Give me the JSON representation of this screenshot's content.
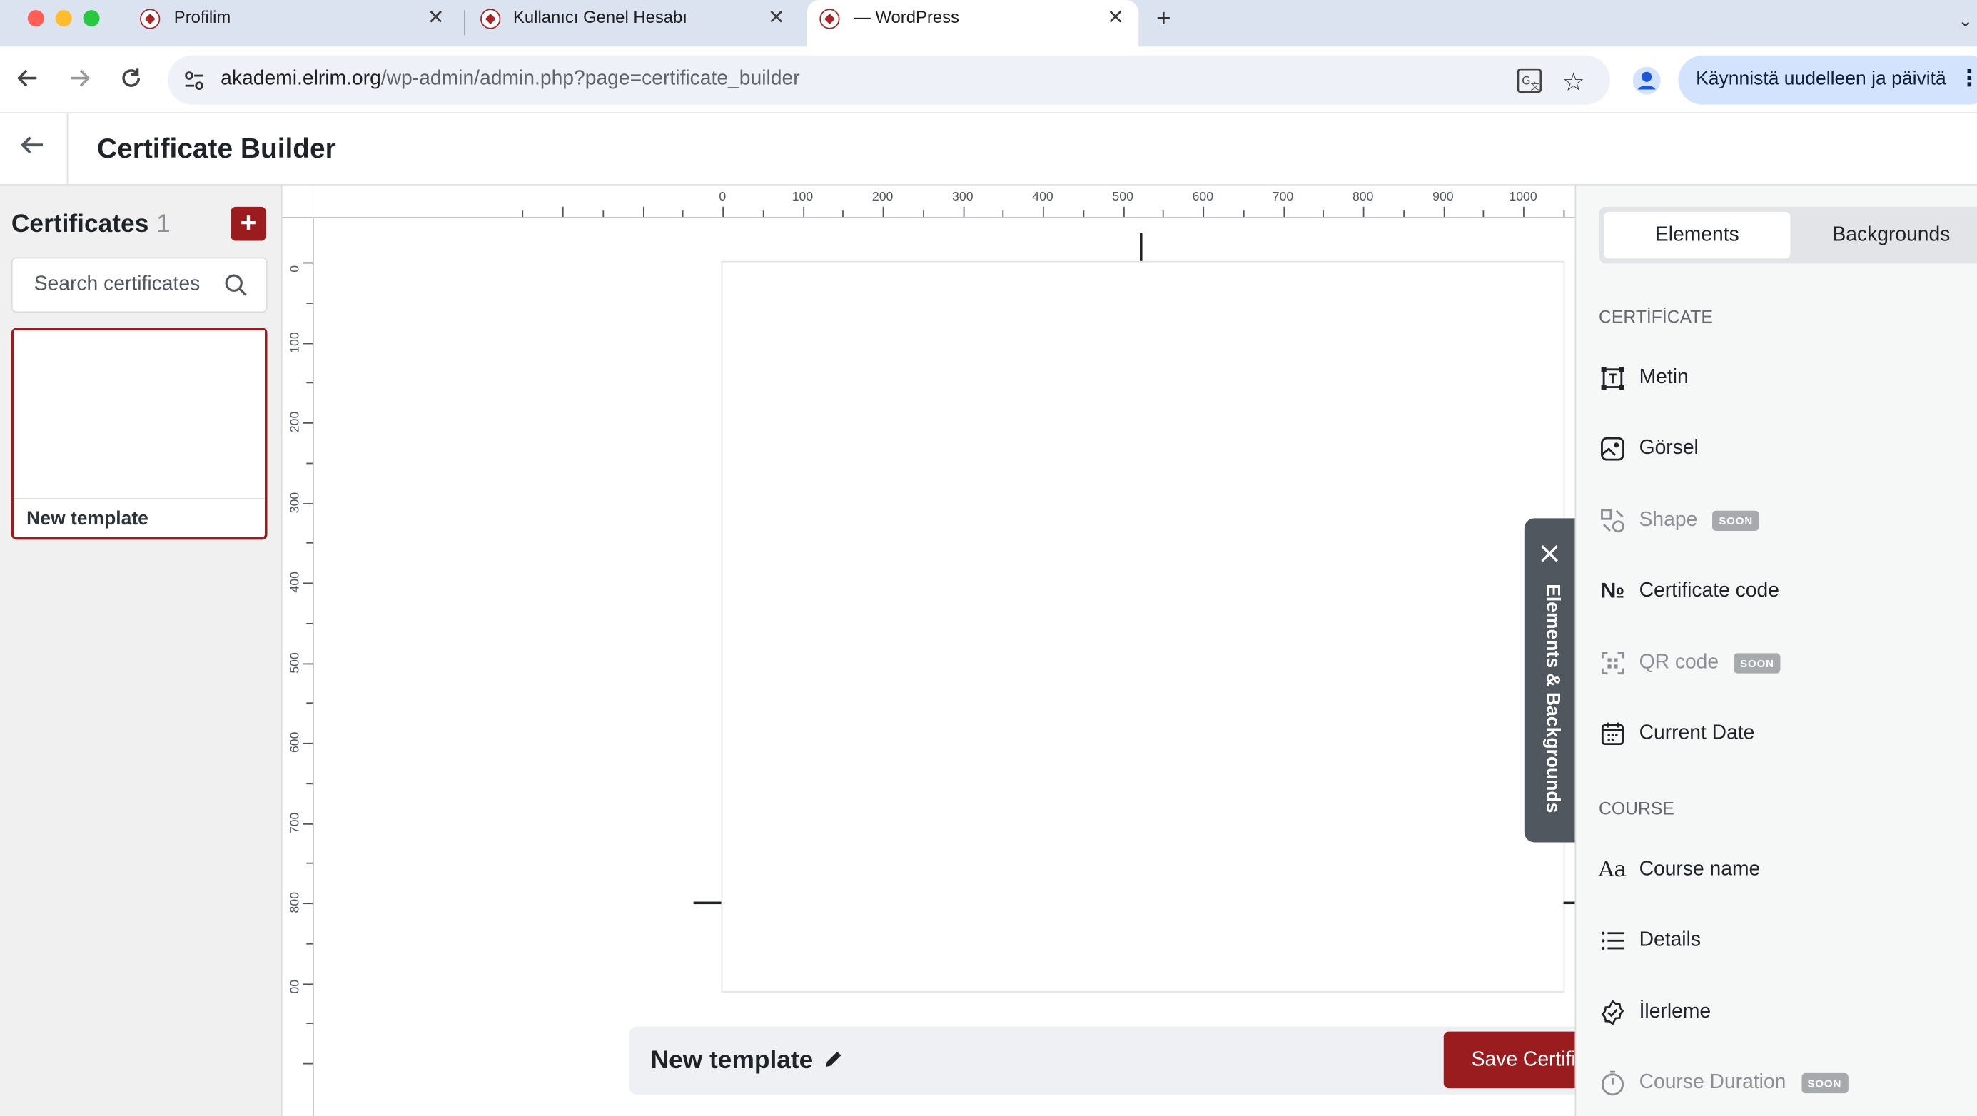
{
  "browser": {
    "tabs": [
      {
        "title": "Profilim"
      },
      {
        "title": "Kullanıcı Genel Hesabı"
      },
      {
        "title": "— WordPress"
      }
    ],
    "url_host": "akademi.elrim.org",
    "url_path": "/wp-admin/admin.php?page=certificate_builder",
    "update_label": "Käynnistä uudelleen ja päivitä"
  },
  "header": {
    "title": "Certificate Builder"
  },
  "sidebar": {
    "heading": "Certificates",
    "count": "1",
    "search_placeholder": "Search certificates",
    "templates": [
      {
        "name": "New template"
      }
    ]
  },
  "ruler": {
    "top_labels": [
      "0",
      "100",
      "200",
      "300",
      "400",
      "500",
      "600",
      "700",
      "800",
      "900",
      "1000"
    ],
    "left_labels": [
      "0",
      "100",
      "200",
      "300",
      "400",
      "500",
      "600",
      "700",
      "800",
      "00"
    ]
  },
  "editor": {
    "template_name": "New template",
    "save_label": "Save Certificate",
    "toggle_label": "Elements & Backgrounds"
  },
  "panel": {
    "tabs": [
      "Elements",
      "Backgrounds"
    ],
    "active_tab": "Elements",
    "section_certificate": "CERTİFİCATE",
    "section_course": "COURSE",
    "soon_label": "SOON",
    "certificate_items": [
      {
        "label": "Metin",
        "icon": "text-frame-icon"
      },
      {
        "label": "Görsel",
        "icon": "image-icon"
      },
      {
        "label": "Shape",
        "icon": "shapes-icon",
        "soon": true
      },
      {
        "label": "Certificate code",
        "icon": "numero-icon"
      },
      {
        "label": "QR code",
        "icon": "qr-code-icon",
        "soon": true
      },
      {
        "label": "Current Date",
        "icon": "calendar-icon"
      }
    ],
    "course_items": [
      {
        "label": "Course name",
        "icon": "typography-icon"
      },
      {
        "label": "Details",
        "icon": "list-icon"
      },
      {
        "label": "İlerleme",
        "icon": "badge-check-icon"
      },
      {
        "label": "Course Duration",
        "icon": "timer-icon",
        "soon": true
      }
    ]
  },
  "colors": {
    "brand": "#9b1c1f",
    "toggle": "#50575e"
  }
}
